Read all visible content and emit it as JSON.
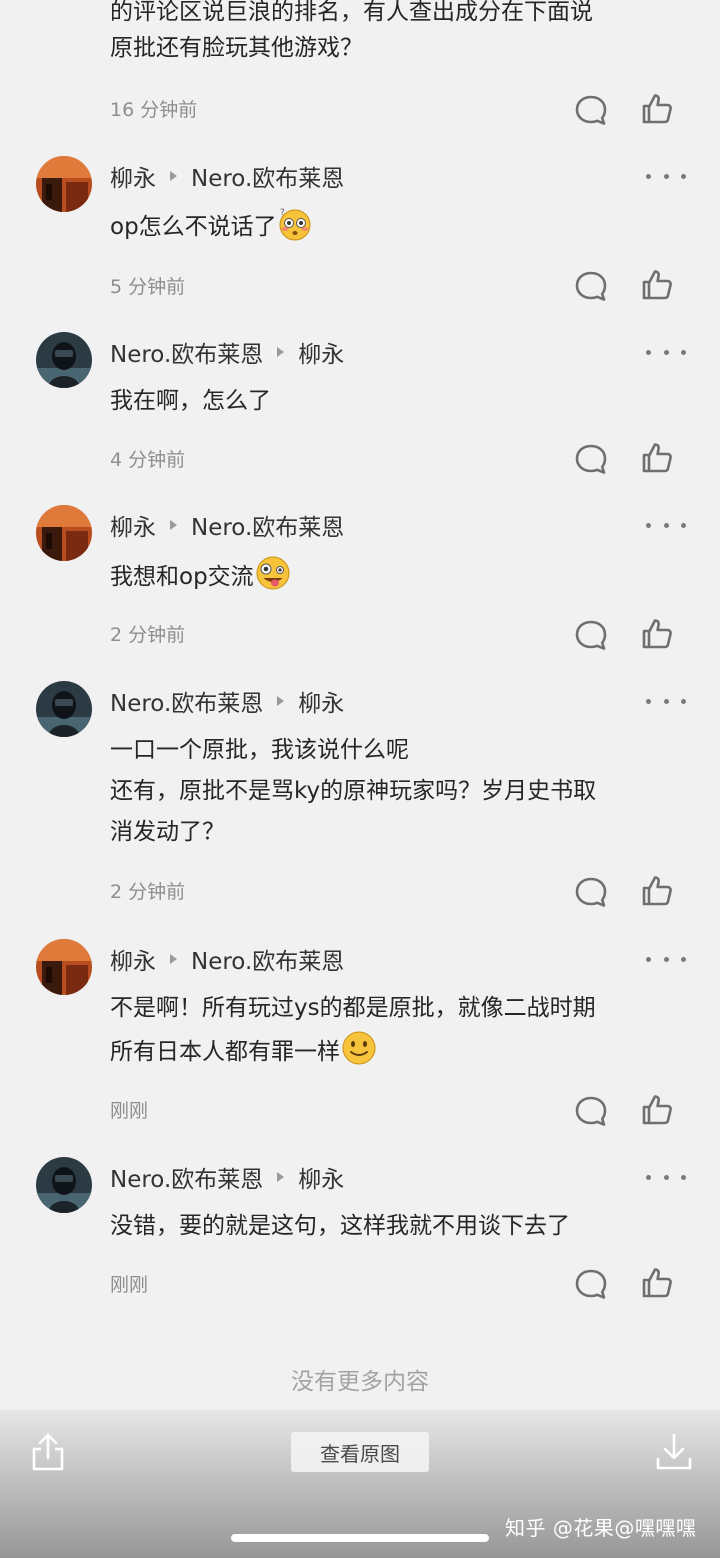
{
  "thread": {
    "top_lines": [
      "的评论区说巨浪的排名，有人查出成分在下面说",
      "原批还有脸玩其他游戏？"
    ],
    "top_time": "16 分钟前",
    "comments": [
      {
        "author": "柳永",
        "reply_to": "Nero.欧布莱恩",
        "lines": [
          "op怎么不说话了"
        ],
        "emoji": "flushed-face",
        "time": "5 分钟前"
      },
      {
        "author": "Nero.欧布莱恩",
        "reply_to": "柳永",
        "lines": [
          "我在啊，怎么了"
        ],
        "time": "4 分钟前"
      },
      {
        "author": "柳永",
        "reply_to": "Nero.欧布莱恩",
        "lines": [
          "我想和op交流"
        ],
        "emoji": "zany-face",
        "time": "2 分钟前"
      },
      {
        "author": "Nero.欧布莱恩",
        "reply_to": "柳永",
        "lines": [
          "一口一个原批，我该说什么呢",
          "还有，原批不是骂ky的原神玩家吗？岁月史书取",
          "消发动了？"
        ],
        "time": "2 分钟前"
      },
      {
        "author": "柳永",
        "reply_to": "Nero.欧布莱恩",
        "lines": [
          "不是啊！所有玩过ys的都是原批，就像二战时期",
          "所有日本人都有罪一样"
        ],
        "emoji": "smiling-face",
        "time": "刚刚"
      },
      {
        "author": "Nero.欧布莱恩",
        "reply_to": "柳永",
        "lines": [
          "没错，要的就是这句，这样我就不用谈下去了"
        ],
        "time": "刚刚"
      }
    ]
  },
  "footer": {
    "no_more": "没有更多内容",
    "view_original": "查看原图",
    "watermark": "知乎 @花果@嘿嘿嘿"
  },
  "icons": {
    "share": "share-icon",
    "download": "download-icon",
    "reply": "comment-icon",
    "like": "thumbs-up-icon",
    "more": "more-dots-icon"
  },
  "colors": {
    "background": "#f1f1f1",
    "text": "#262626",
    "meta": "#8e8e8e",
    "icon": "#6f6f6f"
  }
}
